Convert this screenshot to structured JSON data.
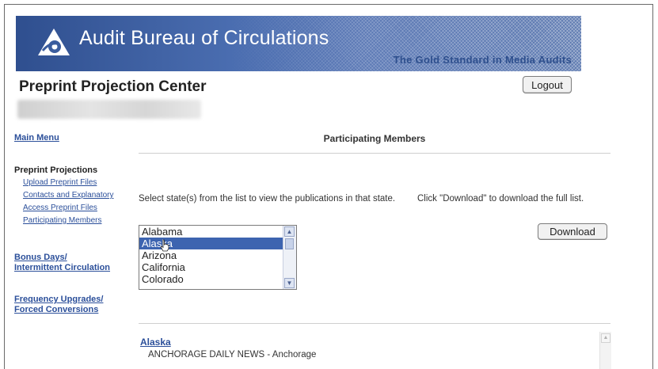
{
  "header": {
    "brand": "Audit Bureau of Circulations",
    "tagline": "The Gold Standard in Media Audits",
    "logo_icon": "abc-logo-icon"
  },
  "page": {
    "title": "Preprint Projection Center",
    "logout_label": "Logout"
  },
  "sidebar": {
    "main_menu": "Main Menu",
    "section_heading": "Preprint Projections",
    "sub_items": [
      "Upload Preprint Files",
      "Contacts and Explanatory",
      "Access Preprint Files",
      "Participating Members"
    ],
    "bonus_line1": "Bonus Days/",
    "bonus_line2": "Intermittent Circulation",
    "freq_line1": "Frequency Upgrades/",
    "freq_line2": "Forced Conversions"
  },
  "main": {
    "section_title": "Participating Members",
    "instruction_left": "Select state(s) from the list to view the publications in that state.",
    "instruction_right": "Click \"Download\" to download the full list.",
    "download_label": "Download",
    "states": [
      "Alabama",
      "Alaska",
      "Arizona",
      "California",
      "Colorado"
    ],
    "selected_state": "Alaska"
  },
  "results": {
    "state": "Alaska",
    "publications": [
      "ANCHORAGE DAILY NEWS - Anchorage"
    ]
  },
  "colors": {
    "banner": "#3b5d9e",
    "link": "#2b4f9a",
    "selection": "#3d64b0"
  }
}
